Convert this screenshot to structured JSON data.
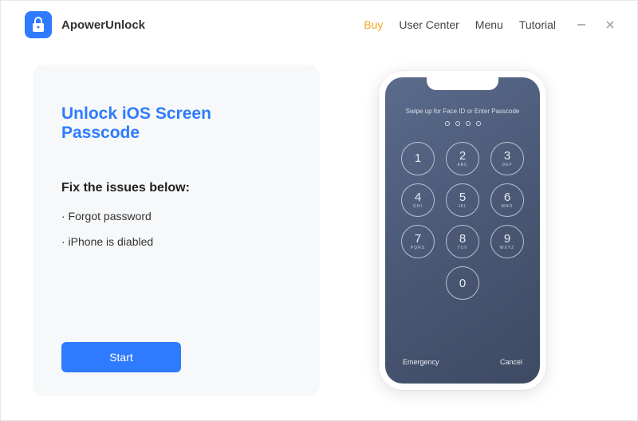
{
  "header": {
    "app_name": "ApowerUnlock",
    "nav": {
      "buy": "Buy",
      "user_center": "User Center",
      "menu": "Menu",
      "tutorial": "Tutorial"
    }
  },
  "card": {
    "title": "Unlock iOS Screen Passcode",
    "issues_heading": "Fix the issues below:",
    "issues": {
      "0": "· Forgot password",
      "1": "· iPhone is diabled"
    },
    "start_label": "Start"
  },
  "phone": {
    "swipe_text": "Swipe up for Face ID or Enter Passcode",
    "keys": {
      "1": {
        "num": "1",
        "let": ""
      },
      "2": {
        "num": "2",
        "let": "ABC"
      },
      "3": {
        "num": "3",
        "let": "DEF"
      },
      "4": {
        "num": "4",
        "let": "GHI"
      },
      "5": {
        "num": "5",
        "let": "JKL"
      },
      "6": {
        "num": "6",
        "let": "MNO"
      },
      "7": {
        "num": "7",
        "let": "PQRS"
      },
      "8": {
        "num": "8",
        "let": "TUV"
      },
      "9": {
        "num": "9",
        "let": "WXYZ"
      },
      "0": {
        "num": "0",
        "let": ""
      }
    },
    "emergency": "Emergency",
    "cancel": "Cancel"
  }
}
